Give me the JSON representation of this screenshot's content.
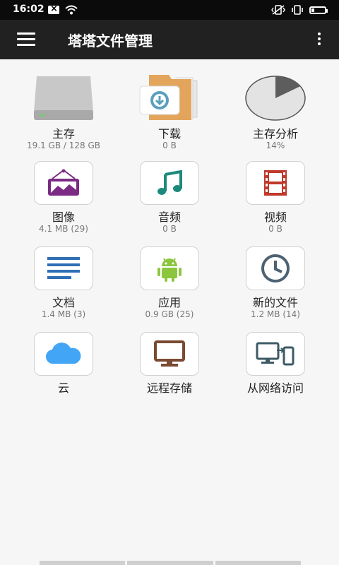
{
  "status_bar": {
    "time": "16:02"
  },
  "toolbar": {
    "title": "塔塔文件管理"
  },
  "items": [
    {
      "label": "主存",
      "sub": "19.1 GB / 128 GB"
    },
    {
      "label": "下载",
      "sub": "0 B"
    },
    {
      "label": "主存分析",
      "sub": "14%",
      "usage_percent": 14
    },
    {
      "label": "图像",
      "sub": "4.1 MB (29)"
    },
    {
      "label": "音频",
      "sub": "0 B"
    },
    {
      "label": "视频",
      "sub": "0 B"
    },
    {
      "label": "文档",
      "sub": "1.4 MB (3)"
    },
    {
      "label": "应用",
      "sub": "0.9 GB (25)"
    },
    {
      "label": "新的文件",
      "sub": "1.2 MB (14)"
    },
    {
      "label": "云"
    },
    {
      "label": "远程存储"
    },
    {
      "label": "从网络访问"
    }
  ]
}
